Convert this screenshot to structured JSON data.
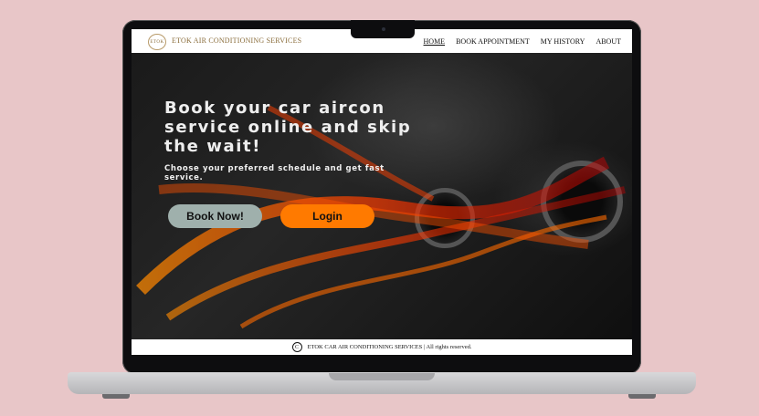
{
  "nav": {
    "logo_text": "ETOK",
    "brand": "ETOK AIR CONDITIONING SERVICES",
    "links": [
      "HOME",
      "BOOK APPOINTMENT",
      "MY HISTORY",
      "ABOUT"
    ]
  },
  "hero": {
    "headline": "Book your car aircon service online and skip the wait!",
    "subtext": "Choose your preferred schedule and get fast service.",
    "book_button": "Book Now!",
    "login_button": "Login"
  },
  "footer": {
    "copyright_symbol": "C",
    "text": "ETOK CAR AIR CONDITIONING SERVICES | All rights reserved."
  },
  "colors": {
    "background": "#e8c6c8",
    "book_button": "#9fb0ac",
    "login_button": "#ff7a00",
    "brand_gold": "#8a6d3b"
  }
}
